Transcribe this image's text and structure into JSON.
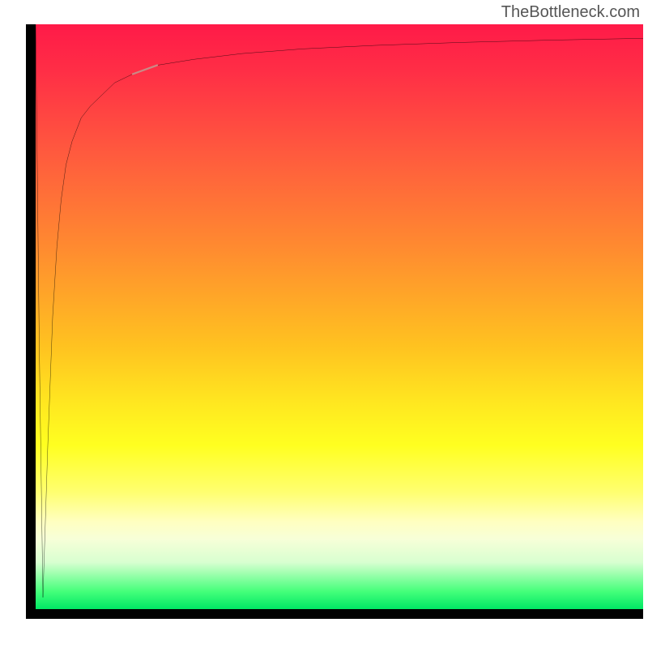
{
  "attribution": "TheBottleneck.com",
  "chart_data": {
    "type": "line",
    "title": "",
    "xlabel": "",
    "ylabel": "",
    "xlim": [
      0,
      100
    ],
    "ylim": [
      0,
      100
    ],
    "grid": false,
    "legend": false,
    "series": [
      {
        "name": "curve",
        "x": [
          0,
          0.6,
          1.2,
          2.0,
          2.8,
          3.5,
          4.2,
          5.0,
          6.0,
          7.5,
          9.0,
          11,
          13,
          16,
          20,
          26,
          34,
          44,
          56,
          70,
          85,
          100
        ],
        "y": [
          100,
          45,
          2,
          28,
          50,
          62,
          70,
          76,
          80,
          84,
          86,
          88,
          90,
          91.5,
          93,
          94,
          95,
          95.8,
          96.4,
          96.9,
          97.3,
          97.6
        ]
      }
    ],
    "highlight_segment": {
      "x_range": [
        14.5,
        22
      ],
      "y_range": [
        90.5,
        93.5
      ],
      "color": "#c98a86"
    },
    "background_gradient": {
      "orientation": "vertical",
      "stops": [
        {
          "pos": 0.0,
          "color": "#ff1a48"
        },
        {
          "pos": 0.38,
          "color": "#ff8a30"
        },
        {
          "pos": 0.72,
          "color": "#ffff20"
        },
        {
          "pos": 0.97,
          "color": "#44ff7a"
        },
        {
          "pos": 1.0,
          "color": "#00e865"
        }
      ]
    }
  }
}
